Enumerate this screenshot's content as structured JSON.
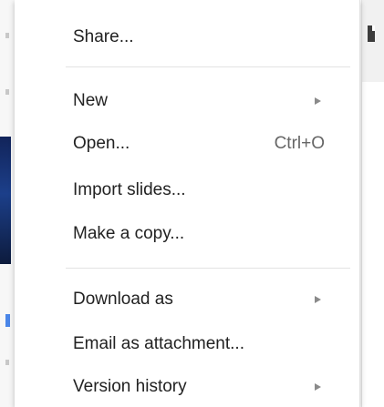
{
  "menu": {
    "items": [
      {
        "label": "Share...",
        "shortcut": "",
        "submenu": false
      },
      {
        "label": "New",
        "shortcut": "",
        "submenu": true
      },
      {
        "label": "Open...",
        "shortcut": "Ctrl+O",
        "submenu": false
      },
      {
        "label": "Import slides...",
        "shortcut": "",
        "submenu": false
      },
      {
        "label": "Make a copy...",
        "shortcut": "",
        "submenu": false
      },
      {
        "label": "Download as",
        "shortcut": "",
        "submenu": true
      },
      {
        "label": "Email as attachment...",
        "shortcut": "",
        "submenu": false
      },
      {
        "label": "Version history",
        "shortcut": "",
        "submenu": true
      }
    ]
  },
  "colors": {
    "menu_background": "#ffffff",
    "text": "#222222",
    "shortcut_text": "#666666",
    "submenu_arrow": "#8a8a8a",
    "separator": "#e3e3e3"
  }
}
